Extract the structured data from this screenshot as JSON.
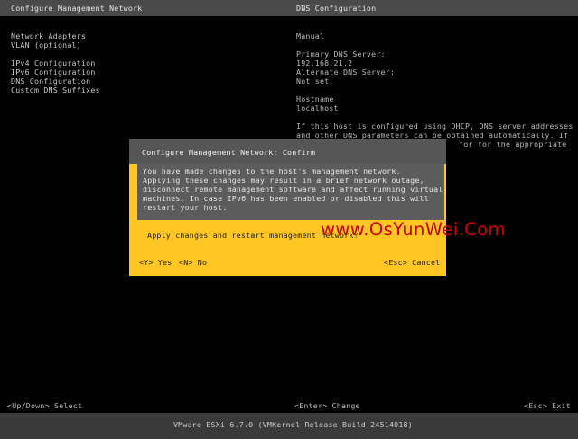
{
  "header": {
    "left_title": "Configure Management Network",
    "right_title": "DNS Configuration"
  },
  "menu": {
    "items": [
      "Network Adapters",
      "VLAN (optional)",
      "IPv4 Configuration",
      "IPv6 Configuration",
      "DNS Configuration",
      "Custom DNS Suffixes"
    ]
  },
  "details": {
    "mode": "Manual",
    "primary_dns_label": "Primary DNS Server:",
    "primary_dns_value": "192.168.21.2",
    "alternate_dns_label": "Alternate DNS Server:",
    "alternate_dns_value": "Not set",
    "hostname_label": "Hostname",
    "hostname_value": "localhost",
    "dhcp_note_line1": "If this host is configured using DHCP, DNS server addresses",
    "dhcp_note_line2": "and other DNS parameters can be obtained automatically. If",
    "dhcp_note_line3": "for for the appropriate"
  },
  "dialog": {
    "title": "Configure Management Network: Confirm",
    "body_lines": [
      "You have made changes to the host's management network.",
      "Applying these changes may result in a brief network outage,",
      "disconnect remote management software and affect running virtual",
      "machines. In case IPv6 has been enabled or disabled this will",
      "restart your host."
    ],
    "question": "Apply changes and restart management network?",
    "yes_label": "<Y> Yes",
    "no_label": "<N> No",
    "cancel_label": "<Esc> Cancel"
  },
  "watermark": "www.OsYunWei.Com",
  "footer": {
    "select_hint": "<Up/Down> Select",
    "change_hint": "<Enter> Change",
    "exit_hint": "<Esc> Exit",
    "version": "VMware ESXi 6.7.0 (VMKernel Release Build 24514018)"
  },
  "colors": {
    "background": "#000000",
    "title_bar": "#4a4a4a",
    "dialog_accent": "#ffc624",
    "dialog_body": "#5c5c5c",
    "watermark": "#cc0000"
  }
}
